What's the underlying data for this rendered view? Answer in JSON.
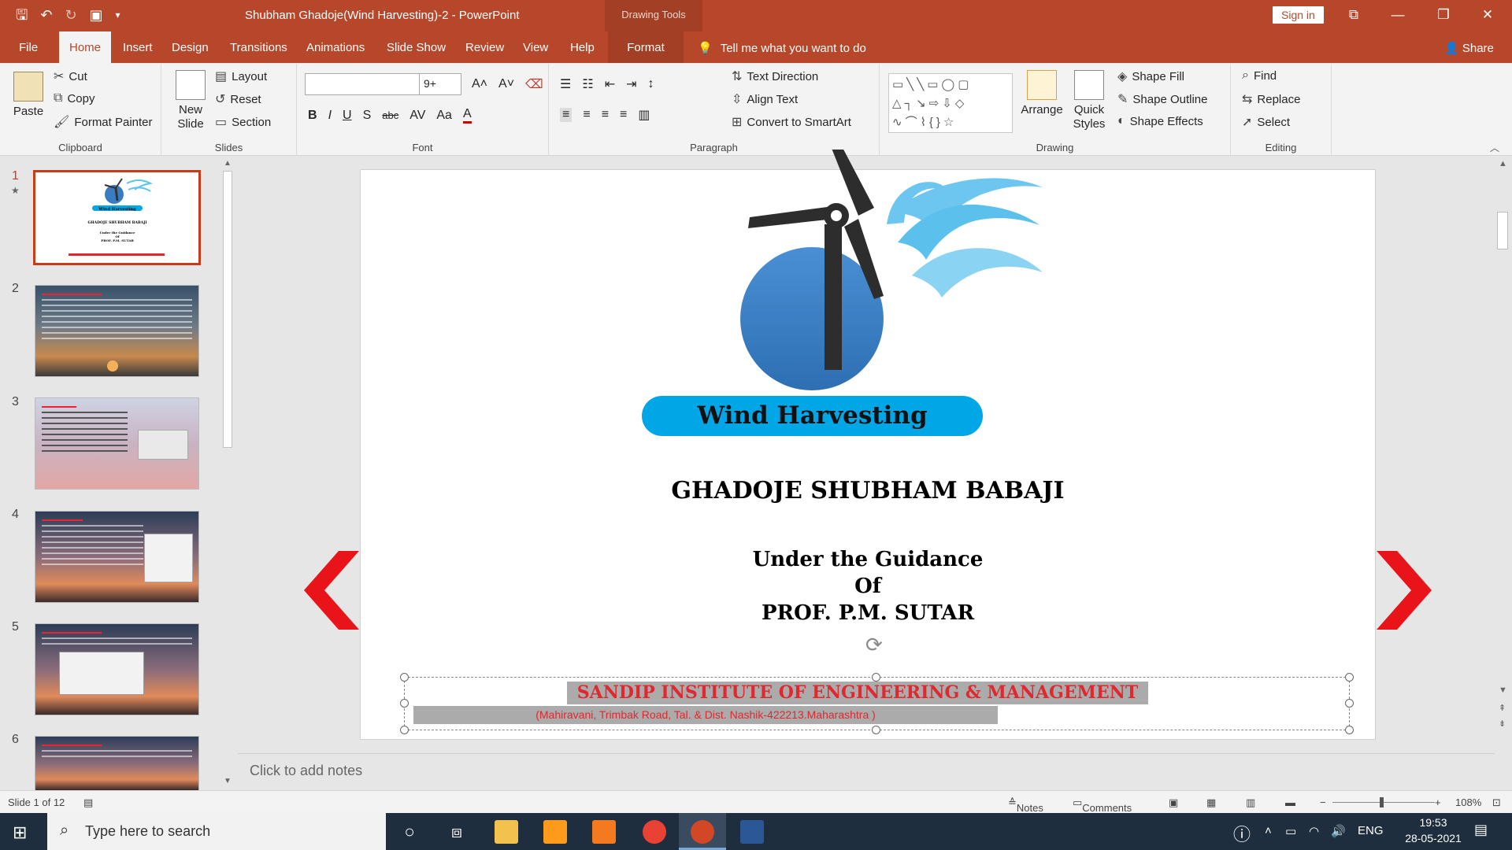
{
  "app": {
    "title": "Shubham Ghadoje(Wind Harvesting)-2  -  PowerPoint",
    "context_tab_group": "Drawing Tools",
    "sign_in": "Sign in"
  },
  "tabs": {
    "file": "File",
    "home": "Home",
    "insert": "Insert",
    "design": "Design",
    "transitions": "Transitions",
    "animations": "Animations",
    "slide_show": "Slide Show",
    "review": "Review",
    "view": "View",
    "help": "Help",
    "format": "Format",
    "tell_me": "Tell me what you want to do",
    "share": "Share"
  },
  "ribbon": {
    "clipboard": {
      "label": "Clipboard",
      "paste": "Paste",
      "cut": "Cut",
      "copy": "Copy",
      "format_painter": "Format Painter"
    },
    "slides": {
      "label": "Slides",
      "new_slide_1": "New",
      "new_slide_2": "Slide",
      "layout": "Layout",
      "reset": "Reset",
      "section": "Section"
    },
    "font": {
      "label": "Font",
      "font_name": "",
      "font_size": "9+"
    },
    "paragraph": {
      "label": "Paragraph",
      "text_direction": "Text Direction",
      "align_text": "Align Text",
      "convert_smartart": "Convert to SmartArt"
    },
    "drawing": {
      "label": "Drawing",
      "arrange": "Arrange",
      "quick_styles_1": "Quick",
      "quick_styles_2": "Styles",
      "shape_fill": "Shape Fill",
      "shape_outline": "Shape Outline",
      "shape_effects": "Shape Effects"
    },
    "editing": {
      "label": "Editing",
      "find": "Find",
      "replace": "Replace",
      "select": "Select"
    }
  },
  "thumbnails": {
    "numbers": [
      "1",
      "2",
      "3",
      "4",
      "5",
      "6"
    ],
    "mini_title": "Wind Harvesting",
    "mini_name": "GHADOJE SHUBHAM BABAJI",
    "mini_guidance": "Under the Guidance",
    "mini_of": "Of",
    "mini_prof": "PROF. P.M. SUTAR"
  },
  "slide": {
    "banner": "Wind Harvesting",
    "name": "GHADOJE SHUBHAM BABAJI",
    "guidance": "Under the Guidance",
    "of": "Of",
    "prof": "PROF. P.M. SUTAR",
    "institute": "SANDIP INSTITUTE OF ENGINEERING & MANAGEMENT",
    "address": "(Mahiravani, Trimbak Road, Tal. & Dist. Nashik-422213.Maharashtra  )"
  },
  "notes_placeholder": "Click to add notes",
  "status": {
    "slide_info": "Slide 1 of 12",
    "notes": "Notes",
    "comments": "Comments",
    "zoom": "108%"
  },
  "taskbar": {
    "search_placeholder": "Type here to search",
    "lang": "ENG",
    "time": "19:53",
    "date": "28-05-2021"
  },
  "colors": {
    "accent": "#b7472a",
    "banner": "#00a6e6",
    "institute_red": "#e0282e",
    "nav_arrow": "#e8141a"
  }
}
